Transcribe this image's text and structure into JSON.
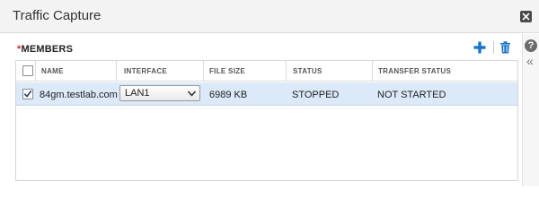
{
  "dialog": {
    "title": "Traffic Capture",
    "close_icon": "close-icon"
  },
  "section": {
    "required_marker": "*",
    "label": "MEMBERS",
    "add_icon": "plus-icon",
    "delete_icon": "trash-icon",
    "help_icon": "question-icon",
    "collapse_icon": "double-chevron-left-icon"
  },
  "table": {
    "columns": [
      "NAME",
      "INTERFACE",
      "FILE SIZE",
      "STATUS",
      "TRANSFER STATUS"
    ],
    "header_checked": false,
    "rows": [
      {
        "checked": true,
        "name": "84gm.testlab.com",
        "interface": "LAN1",
        "file_size": "6989 KB",
        "status": "STOPPED",
        "transfer_status": "NOT STARTED"
      }
    ]
  },
  "colors": {
    "accent": "#1a73c8",
    "required": "#d9262c",
    "selected_row": "#dce9f8"
  }
}
